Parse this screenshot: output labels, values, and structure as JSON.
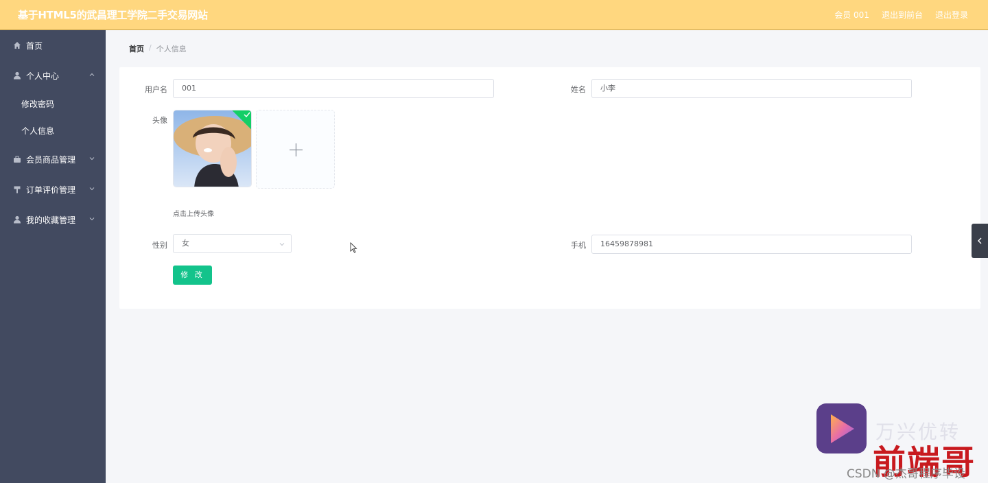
{
  "header": {
    "title": "基于HTML5的武昌理工学院二手交易网站",
    "user": "会员 001",
    "to_front": "退出到前台",
    "logout": "退出登录"
  },
  "sidebar": {
    "items": [
      {
        "label": "首页",
        "icon": "home-icon"
      },
      {
        "label": "个人中心",
        "icon": "user-icon",
        "expanded": true,
        "children": [
          {
            "label": "修改密码"
          },
          {
            "label": "个人信息"
          }
        ]
      },
      {
        "label": "会员商品管理",
        "icon": "briefcase-icon"
      },
      {
        "label": "订单评价管理",
        "icon": "pin-icon"
      },
      {
        "label": "我的收藏管理",
        "icon": "user-icon"
      }
    ]
  },
  "breadcrumb": {
    "home": "首页",
    "separator": "/",
    "current": "个人信息"
  },
  "form": {
    "username_label": "用户名",
    "username_value": "001",
    "name_label": "姓名",
    "name_value": "小李",
    "avatar_label": "头像",
    "upload_tip": "点击上传头像",
    "gender_label": "性别",
    "gender_value": "女",
    "phone_label": "手机",
    "phone_value": "16459878981",
    "submit_label": "修 改"
  },
  "watermark": {
    "brand": "万兴优转",
    "red_text": "前端哥",
    "csdn": "CSDN @杰哥程序毕设"
  },
  "colors": {
    "header_bg": "#ffd77f",
    "sidebar_bg": "#424a60",
    "button_bg": "#13c38b",
    "success": "#13ce66"
  }
}
